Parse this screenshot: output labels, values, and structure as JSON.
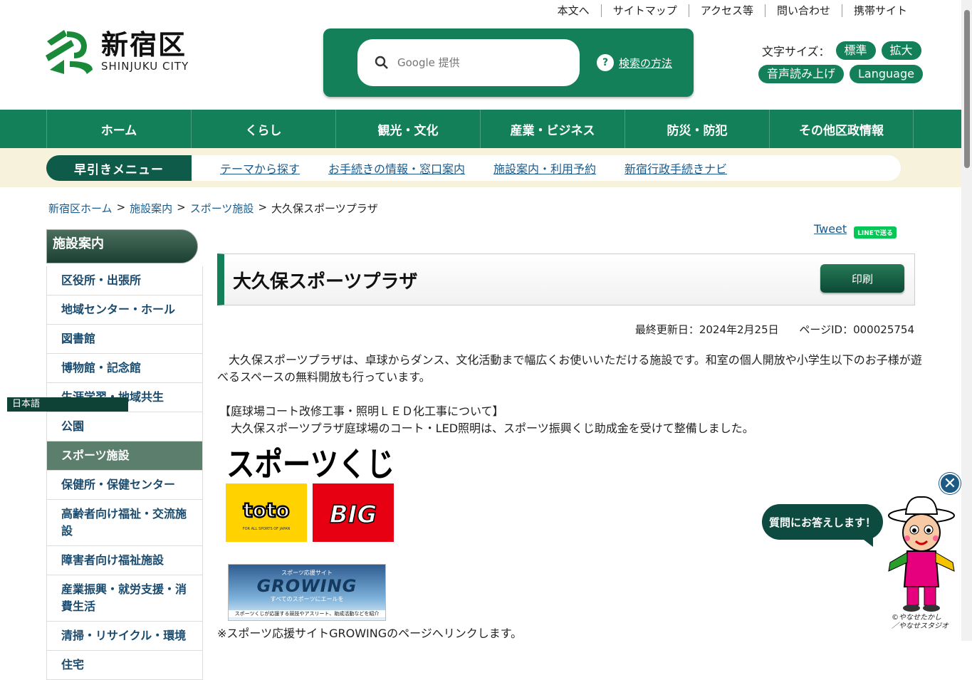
{
  "utility_links": [
    "本文へ",
    "サイトマップ",
    "アクセス等",
    "問い合わせ",
    "携帯サイト"
  ],
  "logo": {
    "kanji": "新宿区",
    "english": "SHINJUKU CITY"
  },
  "search": {
    "placeholder": "Google 提供",
    "help_label": "検索の方法"
  },
  "font_size": {
    "label": "文字サイズ：",
    "standard": "標準",
    "large": "拡大"
  },
  "tools": {
    "voice": "音声読み上げ",
    "language": "Language"
  },
  "global_nav": [
    "ホーム",
    "くらし",
    "観光・文化",
    "産業・ビジネス",
    "防災・防犯",
    "その他区政情報"
  ],
  "quick_menu": {
    "label": "早引きメニュー",
    "links": [
      "テーマから探す",
      "お手続きの情報・窓口案内",
      "施設案内・利用予約",
      "新宿行政手続きナビ"
    ]
  },
  "breadcrumb": {
    "items": [
      "新宿区ホーム",
      "施設案内",
      "スポーツ施設"
    ],
    "current": "大久保スポーツプラザ",
    "separator": ">"
  },
  "sidebar": {
    "heading": "施設案内",
    "items": [
      "区役所・出張所",
      "地域センター・ホール",
      "図書館",
      "博物館・記念館",
      "生涯学習・地域共生",
      "公園",
      "スポーツ施設",
      "保健所・保健センター",
      "高齢者向け福祉・交流施設",
      "障害者向け福祉施設",
      "産業振興・就労支援・消費生活",
      "清掃・リサイクル・環境",
      "住宅"
    ],
    "active_index": 6
  },
  "language_selector": "日本語",
  "share": {
    "tweet": "Tweet",
    "line": "LINEで送る"
  },
  "page": {
    "title": "大久保スポーツプラザ",
    "print": "印刷",
    "updated": "最終更新日：2024年2月25日",
    "page_id": "ページID：000025754",
    "intro": "　大久保スポーツプラザは、卓球からダンス、文化活動まで幅広くお使いいただける施設です。和室の個人開放や小学生以下のお子様が遊べるスペースの無料開放も行っています。",
    "notice_title": "【庭球場コート改修工事・照明ＬＥＤ化工事について】",
    "notice_body": "　大久保スポーツプラザ庭球場のコート・LED照明は、スポーツ振興くじ助成金を受けて整備しました。",
    "growing_note": "※スポーツ応援サイトGROWINGのページへリンクします。"
  },
  "kuji_logo": {
    "title": "スポーツくじ",
    "toto": "toto",
    "big": "BIG",
    "toto_sub": "FOR ALL SPORTS OF JAPAN"
  },
  "growing_banner": {
    "top": "スポーツ応援サイト",
    "name": "GROWING",
    "sub": "すべてのスポーツにエールを",
    "bottom": "スポーツくじが応援する競技やアスリート、助成活動などを紹介"
  },
  "chatbot": {
    "bubble": "質問にお答えします！",
    "close": "✕",
    "credit_line1": "©やなせたかし",
    "credit_line2": "／やなせスタジオ"
  },
  "colors": {
    "primary": "#13805a",
    "dark": "#0f5b49",
    "quick_bg": "#f6f2dc",
    "link": "#1a5b8c"
  }
}
